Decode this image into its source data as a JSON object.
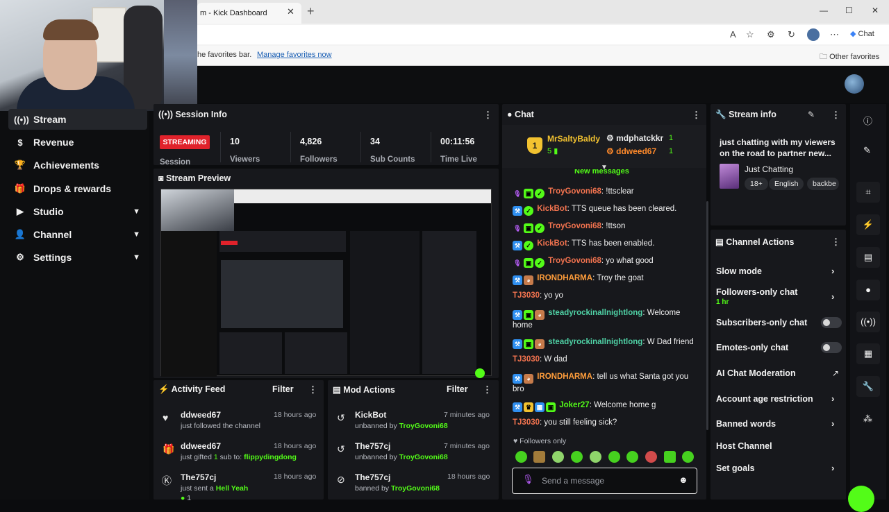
{
  "browser": {
    "tab_title": "m - Kick Dashboard",
    "favbar_text": "he favorites bar.",
    "favbar_link": "Manage favorites now",
    "other_favorites": "Other favorites",
    "copilot_label": "Chat"
  },
  "sidebar": {
    "items": [
      {
        "label": "Stream",
        "icon": "broadcast-icon"
      },
      {
        "label": "Revenue",
        "icon": "coin-icon"
      },
      {
        "label": "Achievements",
        "icon": "trophy-icon"
      },
      {
        "label": "Drops & rewards",
        "icon": "gift-icon"
      },
      {
        "label": "Studio",
        "icon": "video-icon"
      },
      {
        "label": "Channel",
        "icon": "person-icon"
      },
      {
        "label": "Settings",
        "icon": "gear-icon"
      }
    ]
  },
  "session": {
    "title": "Session Info",
    "status": "STREAMING",
    "session_label": "Session",
    "stats": [
      {
        "value": "10",
        "label": "Viewers"
      },
      {
        "value": "4,826",
        "label": "Followers"
      },
      {
        "value": "34",
        "label": "Sub Counts"
      },
      {
        "value": "00:11:56",
        "label": "Time Live"
      }
    ]
  },
  "preview": {
    "title": "Stream Preview"
  },
  "activity": {
    "title": "Activity Feed",
    "filter": "Filter",
    "items": [
      {
        "name": "ddweed67",
        "time": "18 hours ago",
        "desc": "just followed the channel",
        "extra": ""
      },
      {
        "name": "ddweed67",
        "time": "18 hours ago",
        "desc": "just gifted",
        "count": "1",
        "desc2": "sub to:",
        "extra": "flippydingdong"
      },
      {
        "name": "The757cj",
        "time": "18 hours ago",
        "desc": "just sent a",
        "extra": "Hell Yeah",
        "count": "1"
      }
    ]
  },
  "mod": {
    "title": "Mod Actions",
    "filter": "Filter",
    "items": [
      {
        "name": "KickBot",
        "time": "7 minutes ago",
        "desc": "unbanned by",
        "by": "TroyGovoni68"
      },
      {
        "name": "The757cj",
        "time": "7 minutes ago",
        "desc": "unbanned by",
        "by": "TroyGovoni68"
      },
      {
        "name": "The757cj",
        "time": "18 hours ago",
        "desc": "banned by",
        "by": "TroyGovoni68"
      }
    ]
  },
  "chat": {
    "title": "Chat",
    "pinned": {
      "rank": "1",
      "top_user": "MrSaltyBaldy",
      "top_count": "5",
      "user2": "mdphatckkr",
      "user2_count": "1",
      "user3": "ddweed67",
      "user3_count": "1"
    },
    "new_messages": "New messages",
    "messages": [
      {
        "user": "TroyGovoni68",
        "text": "!ttsclear"
      },
      {
        "user": "KickBot",
        "text": "TTS queue has been cleared."
      },
      {
        "user": "TroyGovoni68",
        "text": "!ttson"
      },
      {
        "user": "KickBot",
        "text": "TTS has been enabled."
      },
      {
        "user": "TroyGovoni68",
        "text": "yo what good"
      },
      {
        "user": "IRONDHARMA",
        "text": "Troy the goat"
      },
      {
        "user": "TJ3030",
        "text": "yo yo"
      },
      {
        "user": "steadyrockinallnightlong",
        "text": "Welcome home"
      },
      {
        "user": "steadyrockinallnightlong",
        "text": "W Dad friend"
      },
      {
        "user": "TJ3030",
        "text": "W dad"
      },
      {
        "user": "IRONDHARMA",
        "text": "tell us what Santa got you bro"
      },
      {
        "user": "Joker27",
        "text": "Welcome home g"
      },
      {
        "user": "TJ3030",
        "text": "you still feeling sick?"
      }
    ],
    "followers_only": "Followers only",
    "input_placeholder": "Send a message"
  },
  "stream_info": {
    "title": "Stream info",
    "stream_title": "just chatting with my viewers on the road to partner new...",
    "category": "Just Chatting",
    "tags": [
      "18+",
      "English",
      "backbe"
    ]
  },
  "channel_actions": {
    "title": "Channel Actions",
    "items": [
      {
        "label": "Slow mode",
        "sub": "",
        "control": "chevron"
      },
      {
        "label": "Followers-only chat",
        "sub": "1 hr",
        "control": "chevron"
      },
      {
        "label": "Subscribers-only chat",
        "sub": "",
        "control": "toggle"
      },
      {
        "label": "Emotes-only chat",
        "sub": "",
        "control": "toggle"
      },
      {
        "label": "AI Chat Moderation",
        "sub": "",
        "control": "external"
      },
      {
        "label": "Account age restriction",
        "sub": "",
        "control": "chevron"
      },
      {
        "label": "Banned words",
        "sub": "",
        "control": "chevron"
      },
      {
        "label": "Host Channel",
        "sub": "",
        "control": "none"
      },
      {
        "label": "Set goals",
        "sub": "",
        "control": "chevron"
      }
    ]
  },
  "colors": {
    "accent": "#53fc18",
    "live": "#e0222b",
    "panel": "#17181c",
    "bg": "#0b0c0e"
  }
}
